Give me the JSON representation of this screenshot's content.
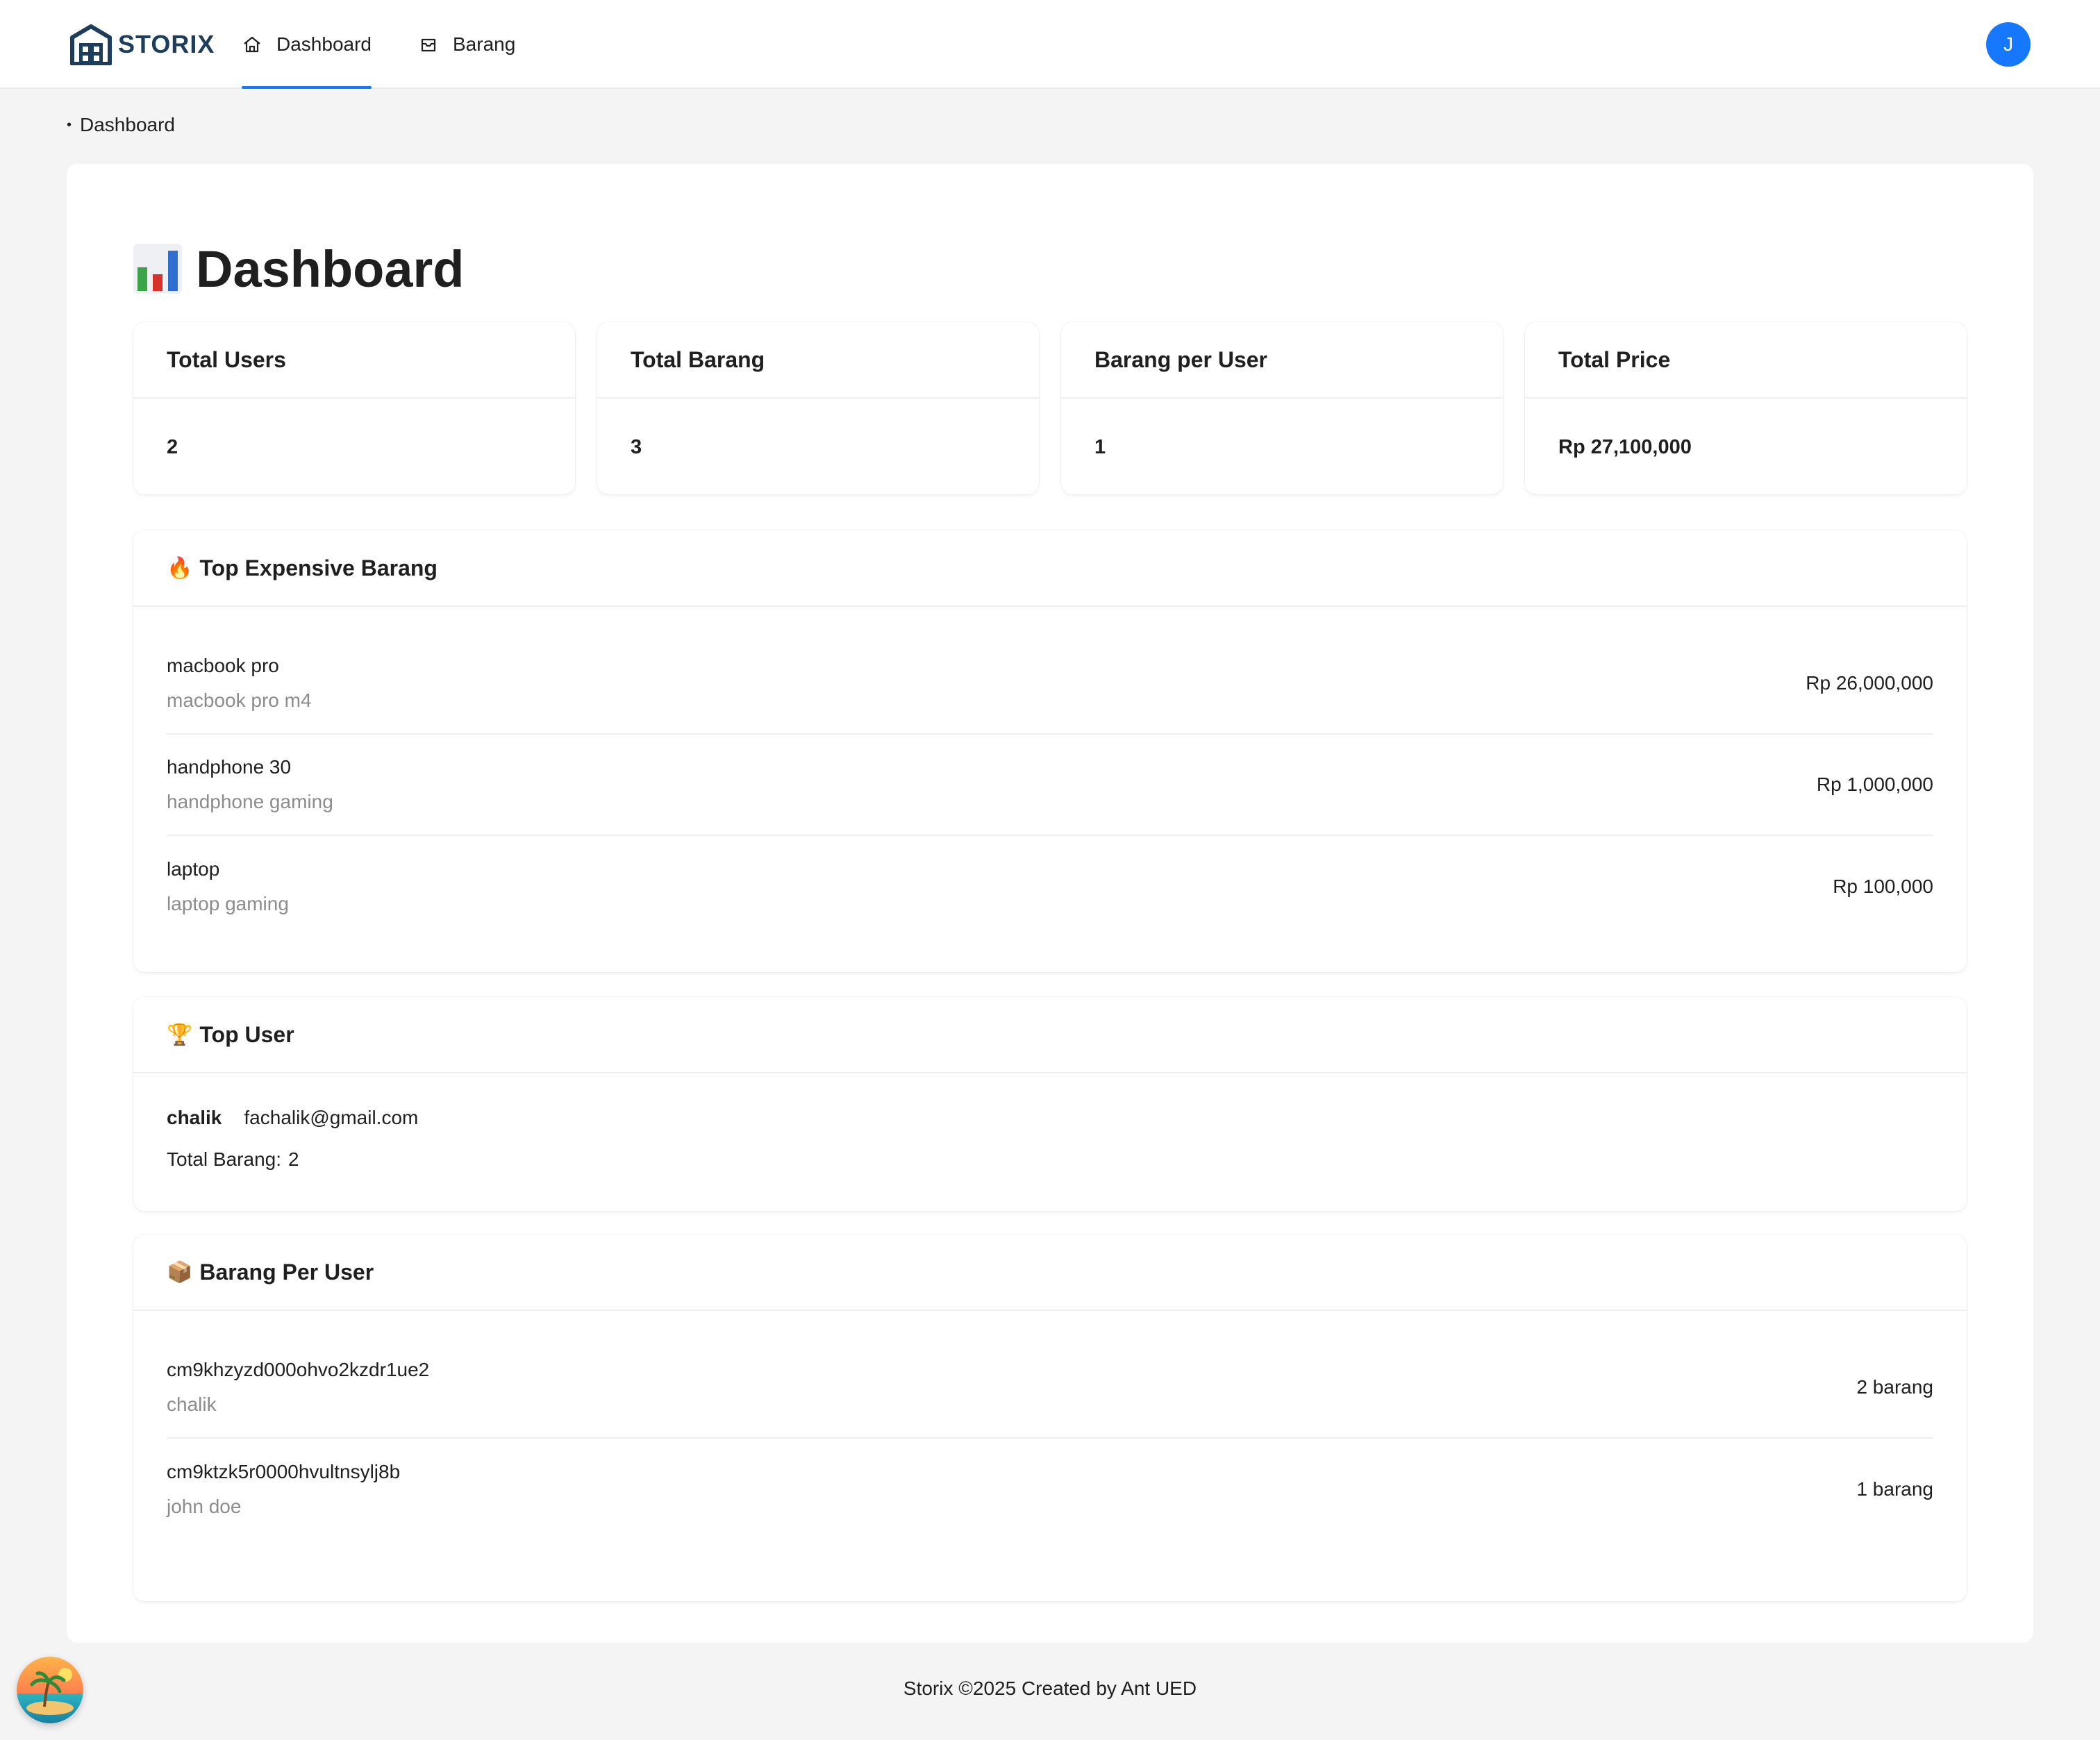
{
  "header": {
    "logo_text": "STORIX",
    "nav": [
      {
        "label": "Dashboard",
        "icon": "home-icon",
        "active": true
      },
      {
        "label": "Barang",
        "icon": "box-icon",
        "active": false
      }
    ],
    "avatar_initial": "J",
    "accent_color": "#1677ff"
  },
  "breadcrumb": {
    "dot": "•",
    "current": "Dashboard"
  },
  "page": {
    "title": "Dashboard",
    "title_icon": "bar-chart-emoji"
  },
  "stats": [
    {
      "label": "Total Users",
      "value": "2"
    },
    {
      "label": "Total Barang",
      "value": "3"
    },
    {
      "label": "Barang per User",
      "value": "1"
    },
    {
      "label": "Total Price",
      "value": "Rp 27,100,000"
    }
  ],
  "top_expensive": {
    "emoji": "🔥",
    "title": "Top Expensive Barang",
    "items": [
      {
        "name": "macbook pro",
        "desc": "macbook pro m4",
        "price": "Rp 26,000,000"
      },
      {
        "name": "handphone 30",
        "desc": "handphone gaming",
        "price": "Rp 1,000,000"
      },
      {
        "name": "laptop",
        "desc": "laptop gaming",
        "price": "Rp 100,000"
      }
    ]
  },
  "top_user": {
    "emoji": "🏆",
    "title": "Top User",
    "name": "chalik",
    "email": "fachalik@gmail.com",
    "total_label": "Total Barang:",
    "total_value": "2"
  },
  "barang_per_user": {
    "emoji": "📦",
    "title": "Barang Per User",
    "items": [
      {
        "id": "cm9khzyzd000ohvo2kzdr1ue2",
        "name": "chalik",
        "count": "2 barang"
      },
      {
        "id": "cm9ktzk5r0000hvultnsylj8b",
        "name": "john doe",
        "count": "1 barang"
      }
    ]
  },
  "footer": {
    "text": "Storix ©2025 Created by Ant UED"
  }
}
